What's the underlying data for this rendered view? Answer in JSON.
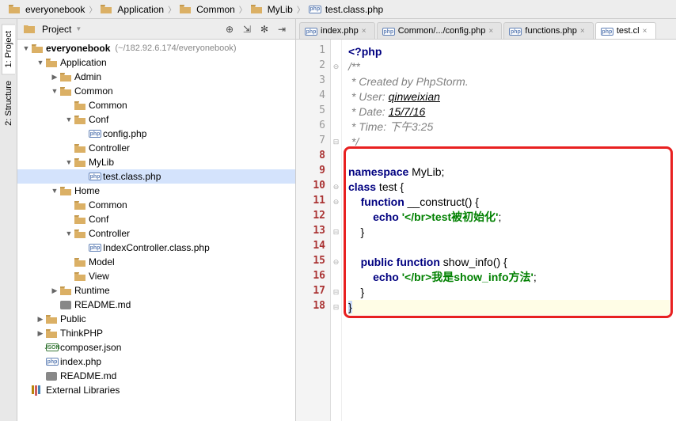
{
  "breadcrumb": [
    {
      "label": "everyonebook",
      "icon": "folder"
    },
    {
      "label": "Application",
      "icon": "folder"
    },
    {
      "label": "Common",
      "icon": "folder"
    },
    {
      "label": "MyLib",
      "icon": "folder"
    },
    {
      "label": "test.class.php",
      "icon": "php"
    }
  ],
  "sidebar_tabs": {
    "project": "1: Project",
    "structure": "2: Structure"
  },
  "project_panel": {
    "title": "Project",
    "root_name": "everyonebook",
    "root_hint": "(~/182.92.6.174/everyonebook)"
  },
  "tree": [
    {
      "d": 0,
      "e": true,
      "icon": "folder",
      "label": "everyonebook",
      "bold": true,
      "hint": "(~/182.92.6.174/everyonebook)"
    },
    {
      "d": 1,
      "e": true,
      "icon": "folder",
      "label": "Application"
    },
    {
      "d": 2,
      "e": null,
      "icon": "folder",
      "label": "Admin"
    },
    {
      "d": 2,
      "e": true,
      "icon": "folder",
      "label": "Common"
    },
    {
      "d": 3,
      "e": null,
      "icon": "folder",
      "label": "Common",
      "noarrow": true
    },
    {
      "d": 3,
      "e": true,
      "icon": "folder",
      "label": "Conf"
    },
    {
      "d": 4,
      "e": null,
      "icon": "php",
      "label": "config.php",
      "noarrow": true
    },
    {
      "d": 3,
      "e": null,
      "icon": "folder",
      "label": "Controller",
      "noarrow": true
    },
    {
      "d": 3,
      "e": true,
      "icon": "folder",
      "label": "MyLib"
    },
    {
      "d": 4,
      "e": null,
      "icon": "php",
      "label": "test.class.php",
      "noarrow": true,
      "selected": true
    },
    {
      "d": 2,
      "e": true,
      "icon": "folder",
      "label": "Home"
    },
    {
      "d": 3,
      "e": null,
      "icon": "folder",
      "label": "Common",
      "noarrow": true
    },
    {
      "d": 3,
      "e": null,
      "icon": "folder",
      "label": "Conf",
      "noarrow": true
    },
    {
      "d": 3,
      "e": true,
      "icon": "folder",
      "label": "Controller"
    },
    {
      "d": 4,
      "e": null,
      "icon": "php",
      "label": "IndexController.class.php",
      "noarrow": true
    },
    {
      "d": 3,
      "e": null,
      "icon": "folder",
      "label": "Model",
      "noarrow": true
    },
    {
      "d": 3,
      "e": null,
      "icon": "folder",
      "label": "View",
      "noarrow": true
    },
    {
      "d": 2,
      "e": null,
      "icon": "folder",
      "label": "Runtime"
    },
    {
      "d": 2,
      "e": null,
      "icon": "md",
      "label": "README.md",
      "noarrow": true
    },
    {
      "d": 1,
      "e": null,
      "icon": "folder",
      "label": "Public"
    },
    {
      "d": 1,
      "e": null,
      "icon": "folder",
      "label": "ThinkPHP"
    },
    {
      "d": 1,
      "e": null,
      "icon": "json",
      "label": "composer.json",
      "noarrow": true
    },
    {
      "d": 1,
      "e": null,
      "icon": "php",
      "label": "index.php",
      "noarrow": true
    },
    {
      "d": 1,
      "e": null,
      "icon": "md",
      "label": "README.md",
      "noarrow": true
    },
    {
      "d": 0,
      "e": null,
      "icon": "lib",
      "label": "External Libraries",
      "noarrow": true
    }
  ],
  "editor_tabs": [
    {
      "label": "index.php",
      "icon": "php",
      "active": false
    },
    {
      "label": "Common/.../config.php",
      "icon": "php",
      "active": false
    },
    {
      "label": "functions.php",
      "icon": "php",
      "active": false
    },
    {
      "label": "test.cl",
      "icon": "php",
      "active": true
    }
  ],
  "code_lines": {
    "line_count": 18,
    "hl_start": 8,
    "hl_end": 18,
    "l1_php": "<?php",
    "l2": "/**",
    "l3": " * Created by PhpStorm.",
    "l4a": " * User: ",
    "l4b": "qinweixian",
    "l5a": " * Date: ",
    "l5b": "15/7/16",
    "l6": " * Time: 下午3:25",
    "l7": " */",
    "l9_ns": "namespace",
    "l9_name": " MyLib;",
    "l10_cls": "class",
    "l10_name": " test ",
    "l10_brace": "{",
    "l11_fn": "function",
    "l11_name": " __construct() {",
    "l12_echo": "echo",
    "l12_str": " '</br>test被初始化'",
    "l12_end": ";",
    "l13": "    }",
    "l15_pub": "public function",
    "l15_name": " show_info() {",
    "l16_echo": "echo",
    "l16_str": " '</br>我是show_info方法'",
    "l16_end": ";",
    "l17": "    }",
    "l18": "}"
  }
}
